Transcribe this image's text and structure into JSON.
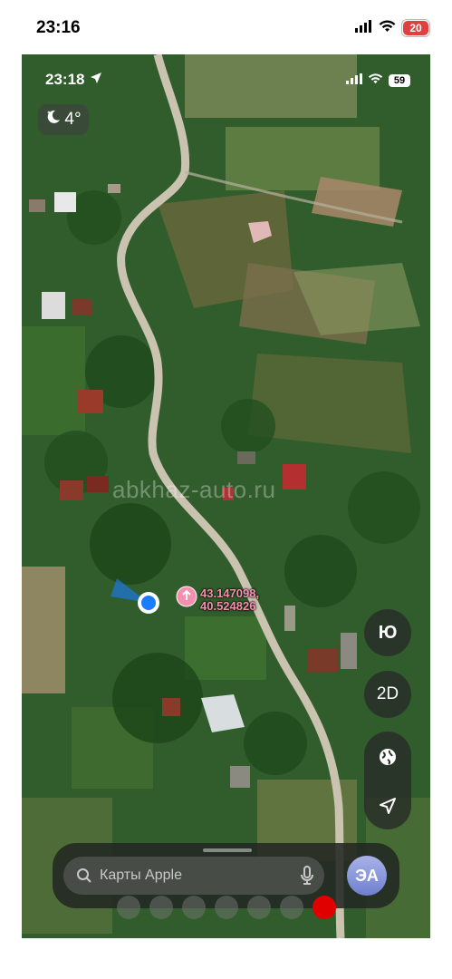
{
  "outer_status": {
    "time": "23:16",
    "battery": "20"
  },
  "inner_status": {
    "time": "23:18",
    "battery": "59"
  },
  "weather": {
    "temperature": "4°",
    "icon": "moon-stars-icon"
  },
  "watermark": "abkhaz-auto.ru",
  "pin": {
    "line1": "43.147098,",
    "line2": "40.524826",
    "icon": "pin-icon"
  },
  "controls": {
    "compass_label": "Ю",
    "view_mode_label": "2D",
    "globe_icon": "globe-icon",
    "location_icon": "location-arrow-icon"
  },
  "search": {
    "placeholder": "Карты Apple",
    "avatar_initials": "ЭА"
  },
  "page_dots": {
    "count": 7,
    "active_index": 6
  },
  "colors": {
    "pin": "#f58fae",
    "active_dot": "#e00000",
    "user_location": "#1a7cff"
  }
}
